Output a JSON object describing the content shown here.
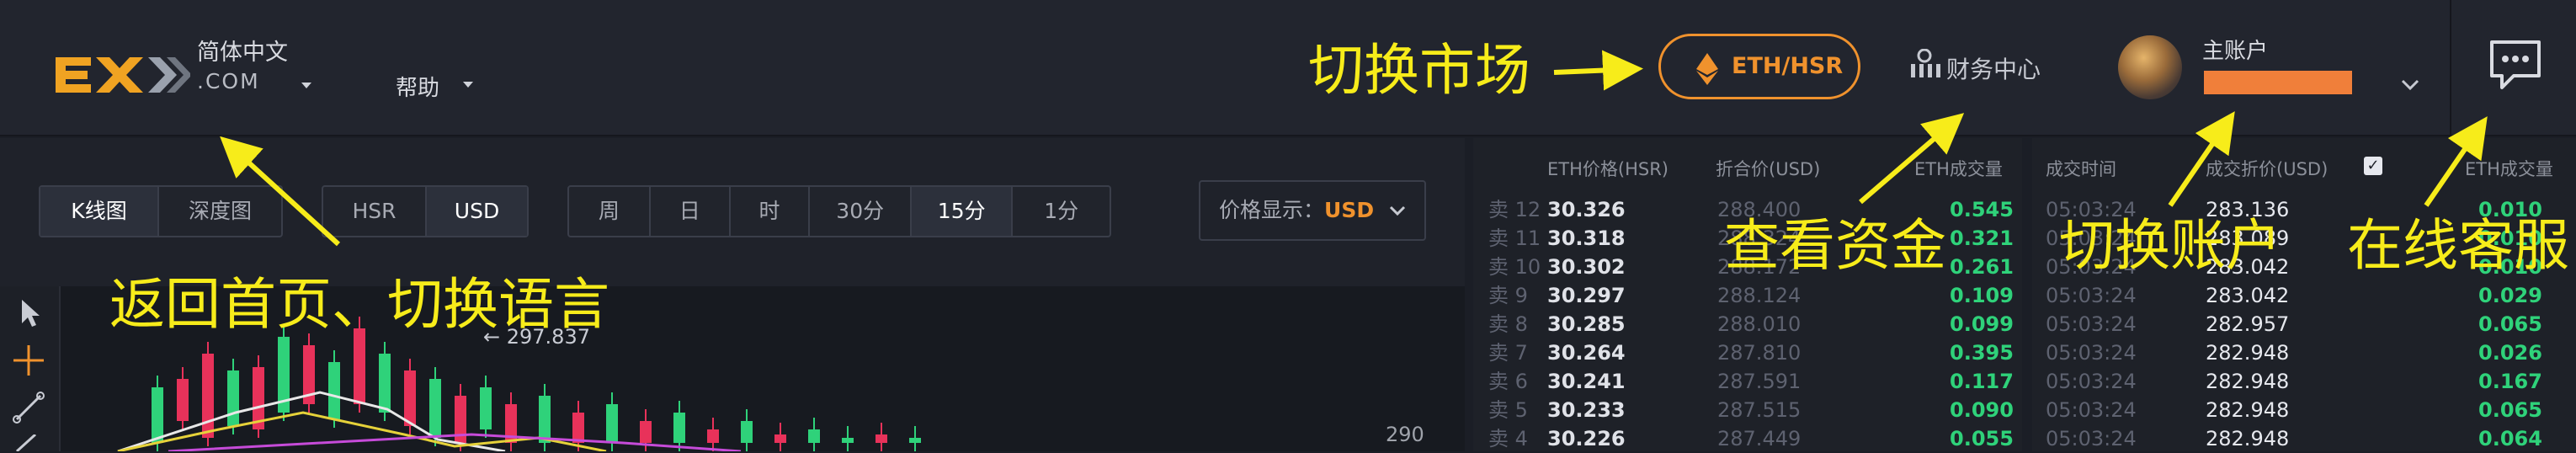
{
  "header": {
    "lang": {
      "line1": "简体中文",
      "line2": ".COM"
    },
    "help_label": "帮助",
    "market": {
      "pair": "ETH/HSR"
    },
    "finance_label": "财务中心",
    "account_label": "主账户"
  },
  "toolbar": {
    "chart_tabs": [
      "K线图",
      "深度图"
    ],
    "currency_tabs": [
      "HSR",
      "USD"
    ],
    "periods": [
      "周",
      "日",
      "时",
      "30分",
      "15分",
      "1分"
    ],
    "price_display": {
      "label": "价格显示：",
      "value": "USD"
    }
  },
  "chart": {
    "peak_label": "← 297.837",
    "axis_tick": "290"
  },
  "orderbook": {
    "headers": [
      "ETH价格(HSR)",
      "折合价(USD)",
      "ETH成交量"
    ],
    "rows": [
      {
        "side": "卖 12",
        "price": "30.326",
        "usd": "288.400",
        "vol": "0.545"
      },
      {
        "side": "卖 11",
        "price": "30.318",
        "usd": "288.324",
        "vol": "0.321"
      },
      {
        "side": "卖 10",
        "price": "30.302",
        "usd": "288.172",
        "vol": "0.261"
      },
      {
        "side": "卖 9",
        "price": "30.297",
        "usd": "288.124",
        "vol": "0.109"
      },
      {
        "side": "卖 8",
        "price": "30.285",
        "usd": "288.010",
        "vol": "0.099"
      },
      {
        "side": "卖 7",
        "price": "30.264",
        "usd": "287.810",
        "vol": "0.395"
      },
      {
        "side": "卖 6",
        "price": "30.241",
        "usd": "287.591",
        "vol": "0.117"
      },
      {
        "side": "卖 5",
        "price": "30.233",
        "usd": "287.515",
        "vol": "0.090"
      },
      {
        "side": "卖 4",
        "price": "30.226",
        "usd": "287.449",
        "vol": "0.055"
      }
    ]
  },
  "trades": {
    "headers": [
      "成交时间",
      "成交折价(USD)",
      "ETH成交量"
    ],
    "rows": [
      {
        "time": "05:03:24",
        "price": "283.136",
        "vol": "0.010"
      },
      {
        "time": "05:03:24",
        "price": "283.089",
        "vol": "0.010"
      },
      {
        "time": "05:03:24",
        "price": "283.042",
        "vol": "0.010"
      },
      {
        "time": "05:03:24",
        "price": "283.042",
        "vol": "0.029"
      },
      {
        "time": "05:03:24",
        "price": "282.957",
        "vol": "0.065"
      },
      {
        "time": "05:03:24",
        "price": "282.948",
        "vol": "0.026"
      },
      {
        "time": "05:03:24",
        "price": "282.948",
        "vol": "0.167"
      },
      {
        "time": "05:03:24",
        "price": "282.948",
        "vol": "0.065"
      },
      {
        "time": "05:03:24",
        "price": "282.948",
        "vol": "0.064"
      }
    ]
  },
  "annotations": {
    "switch_market": "切换市场",
    "home_lang": "返回首页、切换语言",
    "view_funds": "查看资金",
    "switch_account": "切换账户",
    "online_service": "在线客服"
  },
  "colors": {
    "accent": "#f0922d",
    "annotation": "#f7ec1a",
    "buy": "#2fd27a",
    "sell": "#e8325a"
  }
}
